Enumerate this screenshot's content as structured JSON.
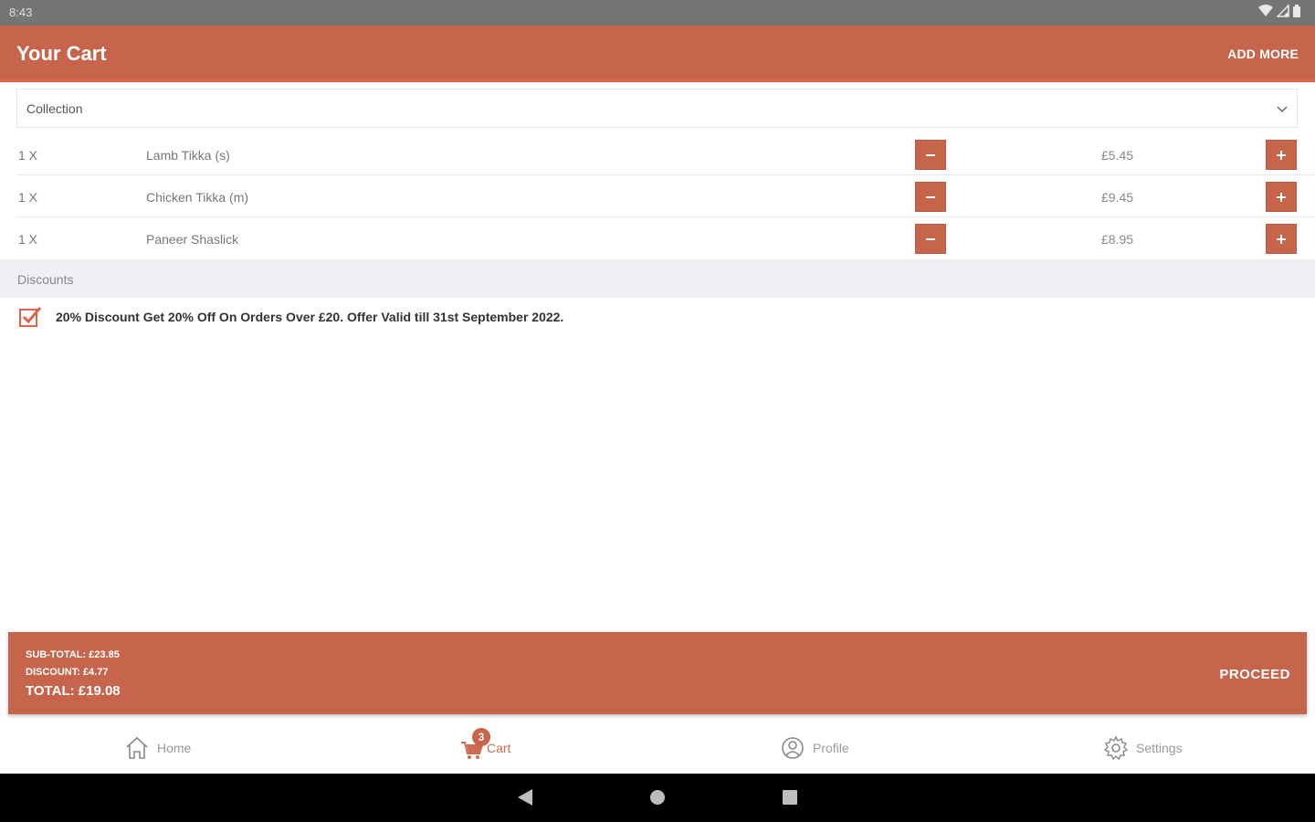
{
  "status_bar": {
    "time": "8:43"
  },
  "header": {
    "title": "Your Cart",
    "add_more": "ADD MORE"
  },
  "order_type": {
    "selected": "Collection"
  },
  "cart_items": [
    {
      "qty": "1 X",
      "name": "Lamb Tikka (s)",
      "price": "£5.45"
    },
    {
      "qty": "1 X",
      "name": "Chicken Tikka (m)",
      "price": "£9.45"
    },
    {
      "qty": "1 X",
      "name": "Paneer Shaslick",
      "price": "£8.95"
    }
  ],
  "discounts": {
    "header": "Discounts",
    "item": "20% Discount Get 20% Off On Orders Over £20. Offer Valid till 31st September 2022.",
    "checked": true
  },
  "summary": {
    "subtotal": "SUB-TOTAL: £23.85",
    "discount": "DISCOUNT: £4.77",
    "total": "TOTAL: £19.08",
    "proceed": "PROCEED"
  },
  "bottom_nav": {
    "home": "Home",
    "cart": "Cart",
    "cart_badge": "3",
    "profile": "Profile",
    "settings": "Settings"
  },
  "colors": {
    "accent": "#c6644c",
    "discount_bg": "#efeff4"
  },
  "icons": [
    "wifi-icon",
    "signal-icon",
    "battery-icon",
    "chevron-down-icon",
    "checkbox-checked-icon",
    "home-icon",
    "cart-icon",
    "profile-icon",
    "settings-icon",
    "back-icon",
    "home-circle-icon",
    "recents-icon"
  ]
}
